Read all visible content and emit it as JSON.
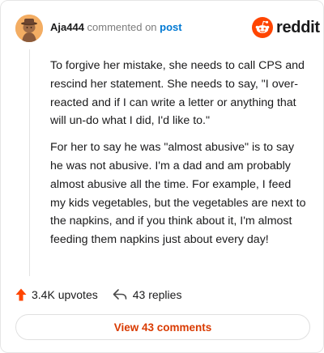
{
  "header": {
    "username": "Aja444",
    "action_text": "commented on",
    "post_link": "post",
    "avatar_icon": "user-avatar-icon",
    "brand_icon": "reddit-alien-icon",
    "brand_name": "reddit"
  },
  "comment": {
    "paragraphs": [
      "To forgive her mistake, she needs to call CPS and rescind her statement. She needs to say, \"I over-reacted and if I can write a letter or anything that will un-do what I did, I'd like to.\"",
      "For her to say he was \"almost abusive\" is to say he was not abusive. I'm a dad and am probably almost abusive all the time. For example, I feed my kids vegetables, but the vegetables are next to the napkins, and if you think about it, I'm almost feeding them napkins just about every day!"
    ]
  },
  "footer": {
    "upvote_icon": "upvote-arrow-icon",
    "upvotes": "3.4K upvotes",
    "reply_icon": "reply-arrow-icon",
    "replies": "43 replies",
    "view_button": "View 43 comments"
  },
  "colors": {
    "brand": "#ff4500",
    "link": "#0079d3",
    "button_text": "#d93a00",
    "avatar_bg": "#f3ad63"
  }
}
